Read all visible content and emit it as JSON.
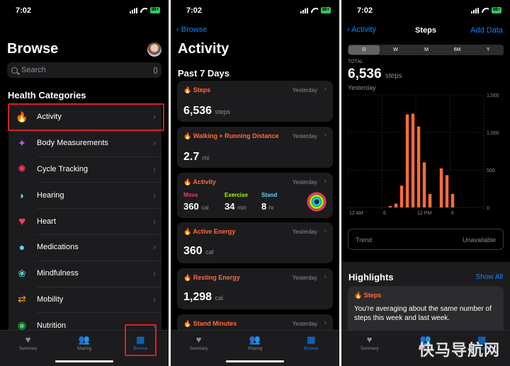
{
  "status": {
    "time": "7:02",
    "battery": "88+"
  },
  "browse": {
    "title": "Browse",
    "search_placeholder": "Search",
    "section_title": "Health Categories",
    "categories": [
      {
        "label": "Activity",
        "icon": "flame-icon",
        "glyph": "🔥",
        "color": "#ff6b3d"
      },
      {
        "label": "Body Measurements",
        "icon": "figure-icon",
        "glyph": "🚶",
        "color": "#bf5af2"
      },
      {
        "label": "Cycle Tracking",
        "icon": "cycle-icon",
        "glyph": "✺",
        "color": "#ff375f"
      },
      {
        "label": "Hearing",
        "icon": "ear-icon",
        "glyph": "👂",
        "color": "#64d2ff"
      },
      {
        "label": "Heart",
        "icon": "heart-icon",
        "glyph": "♥",
        "color": "#ff375f"
      },
      {
        "label": "Medications",
        "icon": "pills-icon",
        "glyph": "💊",
        "color": "#64d2ff"
      },
      {
        "label": "Mindfulness",
        "icon": "mindfulness-icon",
        "glyph": "❀",
        "color": "#5ac8c8"
      },
      {
        "label": "Mobility",
        "icon": "arrows-icon",
        "glyph": "⇄",
        "color": "#ff9f0a"
      },
      {
        "label": "Nutrition",
        "icon": "apple-icon",
        "glyph": "🍏",
        "color": "#30d158"
      }
    ]
  },
  "tabs": {
    "summary": "Summary",
    "sharing": "Sharing",
    "browse": "Browse"
  },
  "activity": {
    "back_label": "Browse",
    "title": "Activity",
    "section": "Past 7 Days",
    "yesterday": "Yesterday",
    "cards": {
      "steps": {
        "title": "Steps",
        "value": "6,536",
        "unit": "steps"
      },
      "distance": {
        "title": "Walking + Running Distance",
        "value": "2.7",
        "unit": "mi"
      },
      "activity": {
        "title": "Activity",
        "move_label": "Move",
        "move_value": "360",
        "move_unit": "cal",
        "exercise_label": "Exercise",
        "exercise_value": "34",
        "exercise_unit": "min",
        "stand_label": "Stand",
        "stand_value": "8",
        "stand_unit": "hr"
      },
      "active_energy": {
        "title": "Active Energy",
        "value": "360",
        "unit": "cal"
      },
      "resting_energy": {
        "title": "Resting Energy",
        "value": "1,298",
        "unit": "cal"
      },
      "stand_minutes": {
        "title": "Stand Minutes"
      }
    }
  },
  "steps": {
    "back_label": "Activity",
    "title": "Steps",
    "add_data": "Add Data",
    "ranges": [
      "D",
      "W",
      "M",
      "6M",
      "Y"
    ],
    "selected_range": "D",
    "total_label": "TOTAL",
    "total_value": "6,536",
    "total_unit": "steps",
    "date_label": "Yesterday",
    "trend_label": "Trend",
    "trend_value": "Unavailable",
    "highlights_title": "Highlights",
    "show_all": "Show All",
    "highlight_card_title": "Steps",
    "highlight_text": "You're averaging about the same number of steps this week and last week."
  },
  "chart_data": {
    "type": "bar",
    "x_ticks": [
      "12 AM",
      "6",
      "12 PM",
      "6"
    ],
    "y_ticks": [
      "1,500",
      "1,000",
      "500",
      "0"
    ],
    "ylim": [
      0,
      1500
    ],
    "hours": [
      0,
      1,
      2,
      3,
      4,
      5,
      6,
      7,
      8,
      9,
      10,
      11,
      12,
      13,
      14,
      15,
      16,
      17,
      18,
      19,
      20,
      21,
      22,
      23
    ],
    "values": [
      0,
      0,
      0,
      0,
      0,
      0,
      0,
      20,
      50,
      290,
      1240,
      1250,
      1080,
      600,
      180,
      0,
      520,
      430,
      180,
      0,
      0,
      0,
      0,
      0
    ],
    "bar_color": "#ff6b3d",
    "grid": true
  },
  "watermark": "快马导航网"
}
